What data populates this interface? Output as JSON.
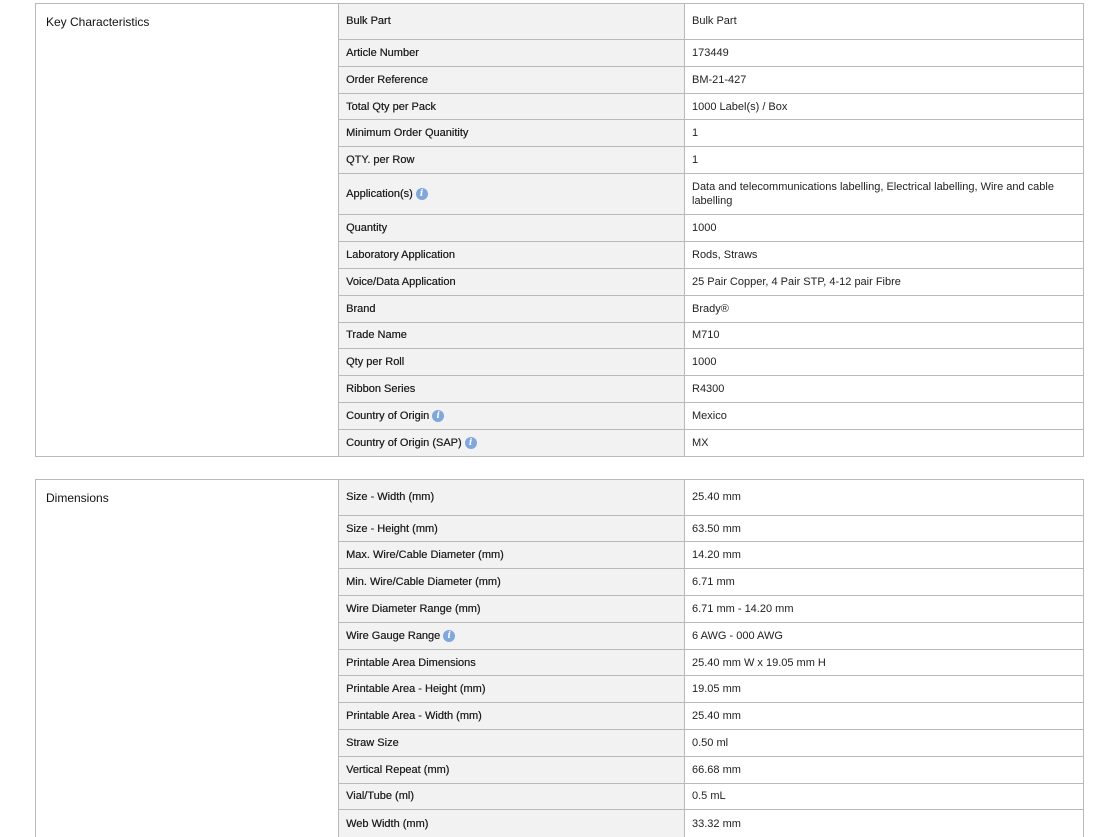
{
  "key_characteristics": {
    "title": "Key Characteristics",
    "rows": [
      {
        "label": "Bulk Part",
        "value": "Bulk Part",
        "info": false
      },
      {
        "label": "Article Number",
        "value": "173449",
        "info": false
      },
      {
        "label": "Order Reference",
        "value": "BM-21-427",
        "info": false
      },
      {
        "label": "Total Qty per Pack",
        "value": "1000 Label(s) / Box",
        "info": false
      },
      {
        "label": "Minimum Order Quanitity",
        "value": "1",
        "info": false
      },
      {
        "label": "QTY. per Row",
        "value": "1",
        "info": false
      },
      {
        "label": "Application(s)",
        "value": "Data and telecommunications labelling, Electrical labelling, Wire and cable labelling",
        "info": true
      },
      {
        "label": "Quantity",
        "value": "1000",
        "info": false
      },
      {
        "label": "Laboratory Application",
        "value": "Rods, Straws",
        "info": false
      },
      {
        "label": "Voice/Data Application",
        "value": "25 Pair Copper, 4 Pair STP, 4-12 pair Fibre",
        "info": false
      },
      {
        "label": "Brand",
        "value": "Brady®",
        "info": false
      },
      {
        "label": "Trade Name",
        "value": "M710",
        "info": false
      },
      {
        "label": "Qty per Roll",
        "value": "1000",
        "info": false
      },
      {
        "label": "Ribbon Series",
        "value": "R4300",
        "info": false
      },
      {
        "label": "Country of Origin",
        "value": "Mexico",
        "info": true
      },
      {
        "label": "Country of Origin (SAP)",
        "value": "MX",
        "info": true
      }
    ]
  },
  "dimensions": {
    "title": "Dimensions",
    "rows": [
      {
        "label": "Size - Width (mm)",
        "value": "25.40 mm",
        "info": false
      },
      {
        "label": "Size - Height (mm)",
        "value": "63.50 mm",
        "info": false
      },
      {
        "label": "Max. Wire/Cable Diameter (mm)",
        "value": "14.20 mm",
        "info": false
      },
      {
        "label": "Min. Wire/Cable Diameter (mm)",
        "value": "6.71 mm",
        "info": false
      },
      {
        "label": "Wire Diameter Range (mm)",
        "value": "6.71 mm - 14.20 mm",
        "info": false
      },
      {
        "label": "Wire Gauge Range",
        "value": "6 AWG - 000 AWG",
        "info": true
      },
      {
        "label": "Printable Area Dimensions",
        "value": "25.40 mm W x 19.05 mm H",
        "info": false
      },
      {
        "label": "Printable Area - Height (mm)",
        "value": "19.05 mm",
        "info": false
      },
      {
        "label": "Printable Area - Width (mm)",
        "value": "25.40 mm",
        "info": false
      },
      {
        "label": "Straw Size",
        "value": "0.50 ml",
        "info": false
      },
      {
        "label": "Vertical Repeat (mm)",
        "value": "66.68 mm",
        "info": false
      },
      {
        "label": "Vial/Tube (ml)",
        "value": "0.5 mL",
        "info": false
      },
      {
        "label": "Web Width (mm)",
        "value": "33.32 mm",
        "info": false
      }
    ]
  },
  "icons": {
    "info_icon": "info-icon",
    "info_glyph": "i",
    "info_color": "#7fa6dd"
  }
}
